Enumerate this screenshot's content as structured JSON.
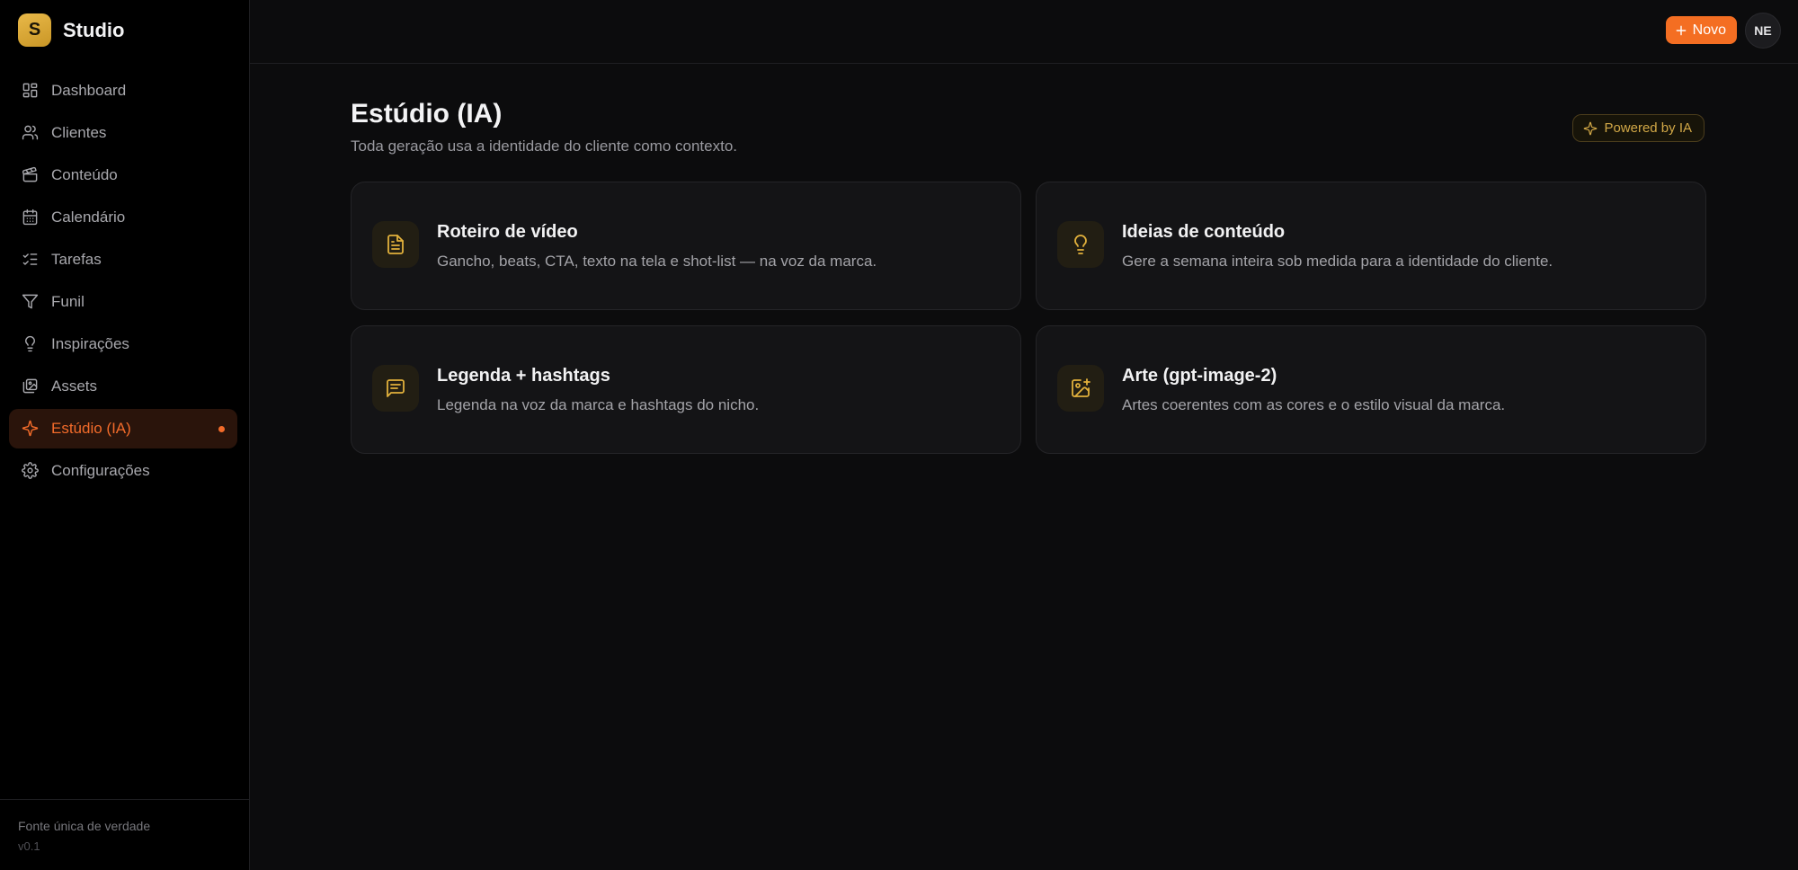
{
  "brand": {
    "logo_letter": "S",
    "name": "Studio",
    "accent": "#e2b13c"
  },
  "nav": {
    "items": [
      {
        "label": "Dashboard",
        "icon": "grid-icon"
      },
      {
        "label": "Clientes",
        "icon": "users-icon"
      },
      {
        "label": "Conteúdo",
        "icon": "clapperboard-icon"
      },
      {
        "label": "Calendário",
        "icon": "calendar-icon"
      },
      {
        "label": "Tarefas",
        "icon": "checklist-icon"
      },
      {
        "label": "Funil",
        "icon": "funnel-icon"
      },
      {
        "label": "Inspirações",
        "icon": "lightbulb-icon"
      },
      {
        "label": "Assets",
        "icon": "images-icon"
      },
      {
        "label": "Estúdio (IA)",
        "icon": "sparkles-icon",
        "active": true
      },
      {
        "label": "Configurações",
        "icon": "gear-icon"
      }
    ],
    "active_color": "#f26b2a"
  },
  "sidebar_footer": {
    "tagline": "Fonte única de verdade",
    "version": "v0.1"
  },
  "topbar": {
    "new_button_label": "Novo",
    "avatar_initials": "NE",
    "new_button_color": "#f46e22"
  },
  "main": {
    "title": "Estúdio (IA)",
    "subtitle": "Toda geração usa a identidade do cliente como contexto.",
    "badge": "Powered by IA",
    "cards": [
      {
        "title": "Roteiro de vídeo",
        "description": "Gancho, beats, CTA, texto na tela e shot-list — na voz da marca.",
        "icon": "document-icon"
      },
      {
        "title": "Ideias de conteúdo",
        "description": "Gere a semana inteira sob medida para a identidade do cliente.",
        "icon": "lightbulb-icon"
      },
      {
        "title": "Legenda + hashtags",
        "description": "Legenda na voz da marca e hashtags do nicho.",
        "icon": "message-text-icon"
      },
      {
        "title": "Arte (gpt-image-2)",
        "description": "Artes coerentes com as cores e o estilo visual da marca.",
        "icon": "image-plus-icon"
      }
    ]
  }
}
